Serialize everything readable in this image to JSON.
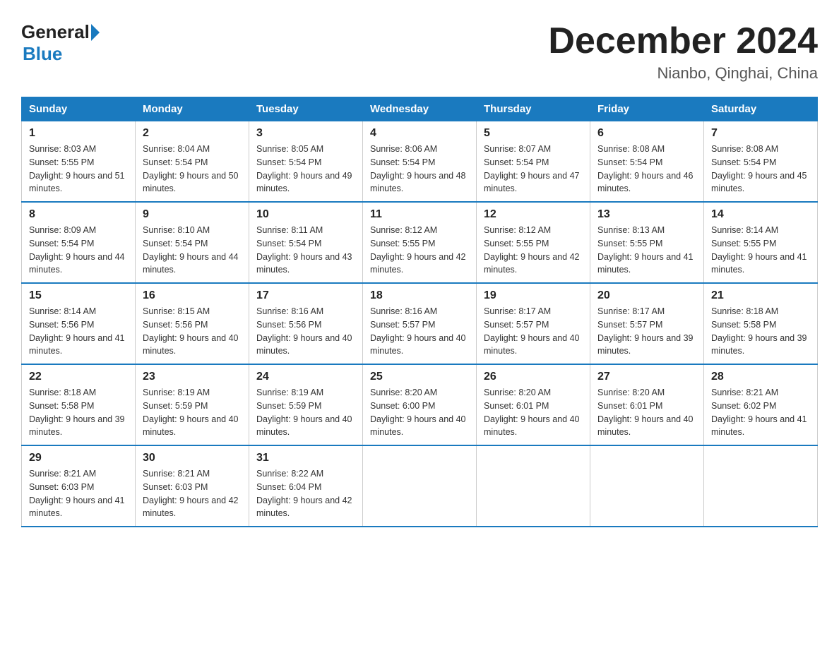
{
  "logo": {
    "general": "General",
    "blue": "Blue"
  },
  "title": "December 2024",
  "subtitle": "Nianbo, Qinghai, China",
  "headers": [
    "Sunday",
    "Monday",
    "Tuesday",
    "Wednesday",
    "Thursday",
    "Friday",
    "Saturday"
  ],
  "weeks": [
    [
      {
        "day": "1",
        "sunrise": "Sunrise: 8:03 AM",
        "sunset": "Sunset: 5:55 PM",
        "daylight": "Daylight: 9 hours and 51 minutes."
      },
      {
        "day": "2",
        "sunrise": "Sunrise: 8:04 AM",
        "sunset": "Sunset: 5:54 PM",
        "daylight": "Daylight: 9 hours and 50 minutes."
      },
      {
        "day": "3",
        "sunrise": "Sunrise: 8:05 AM",
        "sunset": "Sunset: 5:54 PM",
        "daylight": "Daylight: 9 hours and 49 minutes."
      },
      {
        "day": "4",
        "sunrise": "Sunrise: 8:06 AM",
        "sunset": "Sunset: 5:54 PM",
        "daylight": "Daylight: 9 hours and 48 minutes."
      },
      {
        "day": "5",
        "sunrise": "Sunrise: 8:07 AM",
        "sunset": "Sunset: 5:54 PM",
        "daylight": "Daylight: 9 hours and 47 minutes."
      },
      {
        "day": "6",
        "sunrise": "Sunrise: 8:08 AM",
        "sunset": "Sunset: 5:54 PM",
        "daylight": "Daylight: 9 hours and 46 minutes."
      },
      {
        "day": "7",
        "sunrise": "Sunrise: 8:08 AM",
        "sunset": "Sunset: 5:54 PM",
        "daylight": "Daylight: 9 hours and 45 minutes."
      }
    ],
    [
      {
        "day": "8",
        "sunrise": "Sunrise: 8:09 AM",
        "sunset": "Sunset: 5:54 PM",
        "daylight": "Daylight: 9 hours and 44 minutes."
      },
      {
        "day": "9",
        "sunrise": "Sunrise: 8:10 AM",
        "sunset": "Sunset: 5:54 PM",
        "daylight": "Daylight: 9 hours and 44 minutes."
      },
      {
        "day": "10",
        "sunrise": "Sunrise: 8:11 AM",
        "sunset": "Sunset: 5:54 PM",
        "daylight": "Daylight: 9 hours and 43 minutes."
      },
      {
        "day": "11",
        "sunrise": "Sunrise: 8:12 AM",
        "sunset": "Sunset: 5:55 PM",
        "daylight": "Daylight: 9 hours and 42 minutes."
      },
      {
        "day": "12",
        "sunrise": "Sunrise: 8:12 AM",
        "sunset": "Sunset: 5:55 PM",
        "daylight": "Daylight: 9 hours and 42 minutes."
      },
      {
        "day": "13",
        "sunrise": "Sunrise: 8:13 AM",
        "sunset": "Sunset: 5:55 PM",
        "daylight": "Daylight: 9 hours and 41 minutes."
      },
      {
        "day": "14",
        "sunrise": "Sunrise: 8:14 AM",
        "sunset": "Sunset: 5:55 PM",
        "daylight": "Daylight: 9 hours and 41 minutes."
      }
    ],
    [
      {
        "day": "15",
        "sunrise": "Sunrise: 8:14 AM",
        "sunset": "Sunset: 5:56 PM",
        "daylight": "Daylight: 9 hours and 41 minutes."
      },
      {
        "day": "16",
        "sunrise": "Sunrise: 8:15 AM",
        "sunset": "Sunset: 5:56 PM",
        "daylight": "Daylight: 9 hours and 40 minutes."
      },
      {
        "day": "17",
        "sunrise": "Sunrise: 8:16 AM",
        "sunset": "Sunset: 5:56 PM",
        "daylight": "Daylight: 9 hours and 40 minutes."
      },
      {
        "day": "18",
        "sunrise": "Sunrise: 8:16 AM",
        "sunset": "Sunset: 5:57 PM",
        "daylight": "Daylight: 9 hours and 40 minutes."
      },
      {
        "day": "19",
        "sunrise": "Sunrise: 8:17 AM",
        "sunset": "Sunset: 5:57 PM",
        "daylight": "Daylight: 9 hours and 40 minutes."
      },
      {
        "day": "20",
        "sunrise": "Sunrise: 8:17 AM",
        "sunset": "Sunset: 5:57 PM",
        "daylight": "Daylight: 9 hours and 39 minutes."
      },
      {
        "day": "21",
        "sunrise": "Sunrise: 8:18 AM",
        "sunset": "Sunset: 5:58 PM",
        "daylight": "Daylight: 9 hours and 39 minutes."
      }
    ],
    [
      {
        "day": "22",
        "sunrise": "Sunrise: 8:18 AM",
        "sunset": "Sunset: 5:58 PM",
        "daylight": "Daylight: 9 hours and 39 minutes."
      },
      {
        "day": "23",
        "sunrise": "Sunrise: 8:19 AM",
        "sunset": "Sunset: 5:59 PM",
        "daylight": "Daylight: 9 hours and 40 minutes."
      },
      {
        "day": "24",
        "sunrise": "Sunrise: 8:19 AM",
        "sunset": "Sunset: 5:59 PM",
        "daylight": "Daylight: 9 hours and 40 minutes."
      },
      {
        "day": "25",
        "sunrise": "Sunrise: 8:20 AM",
        "sunset": "Sunset: 6:00 PM",
        "daylight": "Daylight: 9 hours and 40 minutes."
      },
      {
        "day": "26",
        "sunrise": "Sunrise: 8:20 AM",
        "sunset": "Sunset: 6:01 PM",
        "daylight": "Daylight: 9 hours and 40 minutes."
      },
      {
        "day": "27",
        "sunrise": "Sunrise: 8:20 AM",
        "sunset": "Sunset: 6:01 PM",
        "daylight": "Daylight: 9 hours and 40 minutes."
      },
      {
        "day": "28",
        "sunrise": "Sunrise: 8:21 AM",
        "sunset": "Sunset: 6:02 PM",
        "daylight": "Daylight: 9 hours and 41 minutes."
      }
    ],
    [
      {
        "day": "29",
        "sunrise": "Sunrise: 8:21 AM",
        "sunset": "Sunset: 6:03 PM",
        "daylight": "Daylight: 9 hours and 41 minutes."
      },
      {
        "day": "30",
        "sunrise": "Sunrise: 8:21 AM",
        "sunset": "Sunset: 6:03 PM",
        "daylight": "Daylight: 9 hours and 42 minutes."
      },
      {
        "day": "31",
        "sunrise": "Sunrise: 8:22 AM",
        "sunset": "Sunset: 6:04 PM",
        "daylight": "Daylight: 9 hours and 42 minutes."
      },
      null,
      null,
      null,
      null
    ]
  ]
}
